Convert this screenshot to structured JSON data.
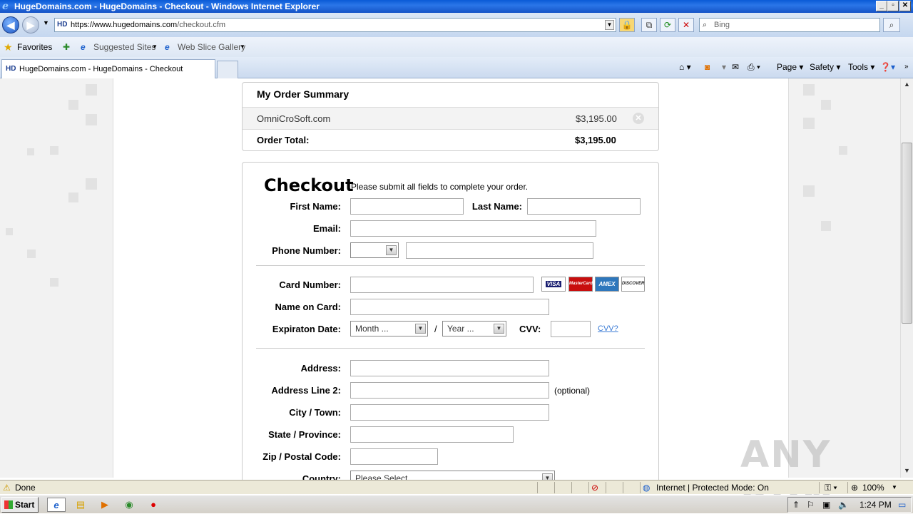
{
  "window": {
    "title": "HugeDomains.com - HugeDomains - Checkout - Windows Internet Explorer"
  },
  "nav": {
    "url_scheme_host": "https://www.hugedomains.com",
    "url_path": "/checkout.cfm",
    "search_placeholder": "Bing"
  },
  "favorites": {
    "favorites_label": "Favorites",
    "suggested_label": "Suggested Sites",
    "webslice_label": "Web Slice Gallery"
  },
  "tabs": [
    {
      "label": "HugeDomains.com - HugeDomains - Checkout"
    }
  ],
  "commands": {
    "page": "Page",
    "safety": "Safety",
    "tools": "Tools"
  },
  "summary": {
    "title": "My Order Summary",
    "items": [
      {
        "domain": "OmniCroSoft.com",
        "price": "$3,195.00"
      }
    ],
    "total_label": "Order Total:",
    "total_value": "$3,195.00"
  },
  "checkout": {
    "title": "Checkout",
    "subtitle": "Please submit all fields to complete your order.",
    "first_name_label": "First Name:",
    "last_name_label": "Last Name:",
    "email_label": "Email:",
    "phone_label": "Phone Number:",
    "card_number_label": "Card Number:",
    "name_on_card_label": "Name on Card:",
    "expiration_label": "Expiraton Date:",
    "month_placeholder": "Month ...",
    "year_placeholder": "Year ...",
    "slash": "/",
    "cvv_label": "CVV:",
    "cvv_help": "CVV?",
    "address_label": "Address:",
    "address2_label": "Address Line 2:",
    "optional": "(optional)",
    "city_label": "City / Town:",
    "state_label": "State / Province:",
    "zip_label": "Zip / Postal Code:",
    "country_label": "Country:",
    "country_placeholder": "Please Select ...",
    "cards": [
      {
        "name": "VISA",
        "color": "#1a1f71"
      },
      {
        "name": "MasterCard",
        "color": "#eb001b"
      },
      {
        "name": "AMEX",
        "color": "#2e77bc"
      },
      {
        "name": "DISCOVER",
        "color": "#f58220"
      }
    ]
  },
  "status": {
    "text": "Done",
    "zone": "Internet | Protected Mode: On",
    "zoom": "100%"
  },
  "taskbar": {
    "start": "Start",
    "time": "1:24 PM"
  },
  "watermark": "ANY RUN"
}
